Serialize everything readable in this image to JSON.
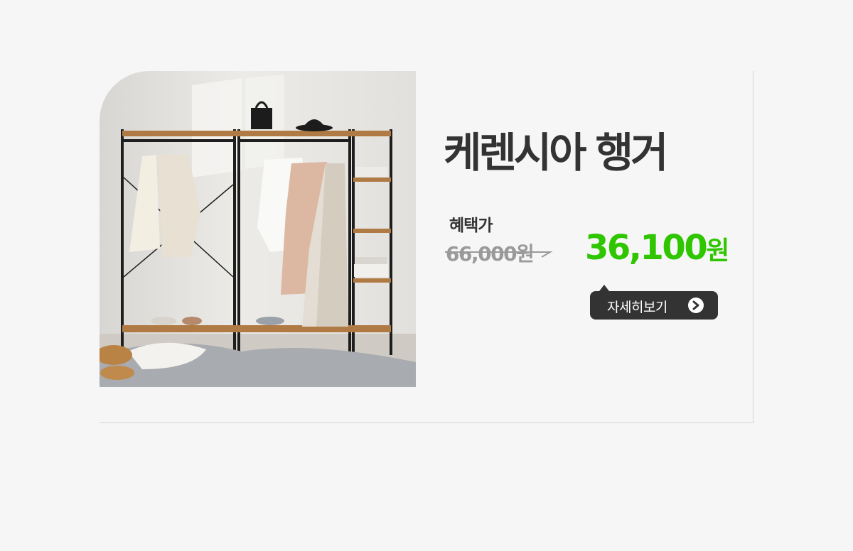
{
  "product": {
    "title": "케렌시아 행거",
    "image_alt": "hanger-product-photo",
    "benefit_label": "혜택가",
    "original_price": "66,000원",
    "sale_price": "36,100",
    "sale_unit": "원"
  },
  "cta": {
    "label": "자세히보기",
    "icon": "chevron-right-circle-icon"
  },
  "colors": {
    "background": "#f6f6f6",
    "title": "#333333",
    "sale_price": "#2fc600",
    "original_price": "#9a9a9a",
    "button_bg": "#333333"
  }
}
